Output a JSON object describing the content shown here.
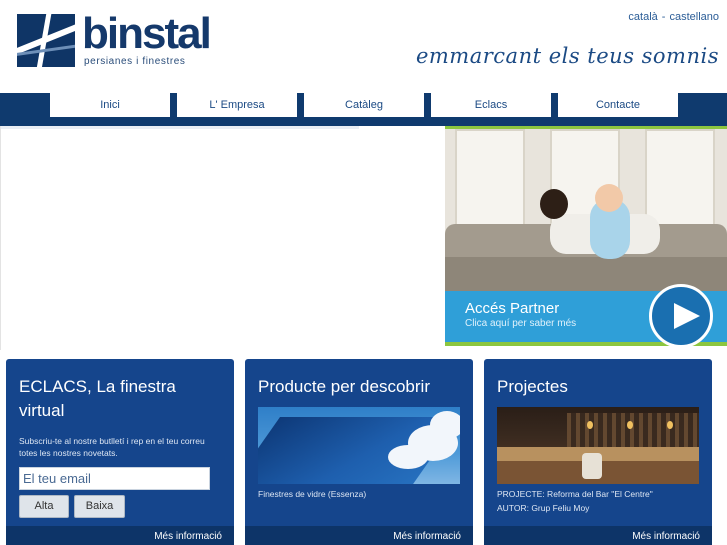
{
  "header": {
    "logo_text": "binstal",
    "logo_tagline": "persianes i finestres",
    "languages": [
      "català",
      "castellano"
    ],
    "language_separator": "-",
    "slogan": "emmarcant els teus somnis"
  },
  "nav": {
    "items": [
      "Inici",
      "L' Empresa",
      "Catàleg",
      "Eclacs",
      "Contacte"
    ]
  },
  "partner": {
    "title": "Accés Partner",
    "subtitle": "Clica aquí per saber més"
  },
  "cards": {
    "eclacs": {
      "title": "ECLACS, La finestra virtual",
      "text": "Subscriu-te al nostre butlletí i rep en el teu correu totes les nostres novetats.",
      "email_placeholder": "El teu email",
      "btn_alta": "Alta",
      "btn_baixa": "Baixa",
      "more": "Més informació"
    },
    "producte": {
      "title": "Producte per descobrir",
      "caption": "Finestres de vidre (Essenza)",
      "more": "Més informació"
    },
    "projectes": {
      "title": "Projectes",
      "line1": "PROJECTE: Reforma del Bar \"El Centre\"",
      "line2": "AUTOR: Grup Feliu Moy",
      "more": "Més informació"
    }
  },
  "colors": {
    "navy": "#0f3a6e",
    "card_blue": "#15458c",
    "partner_blue": "#2f9fd8",
    "accent_green": "#8cc63f"
  }
}
